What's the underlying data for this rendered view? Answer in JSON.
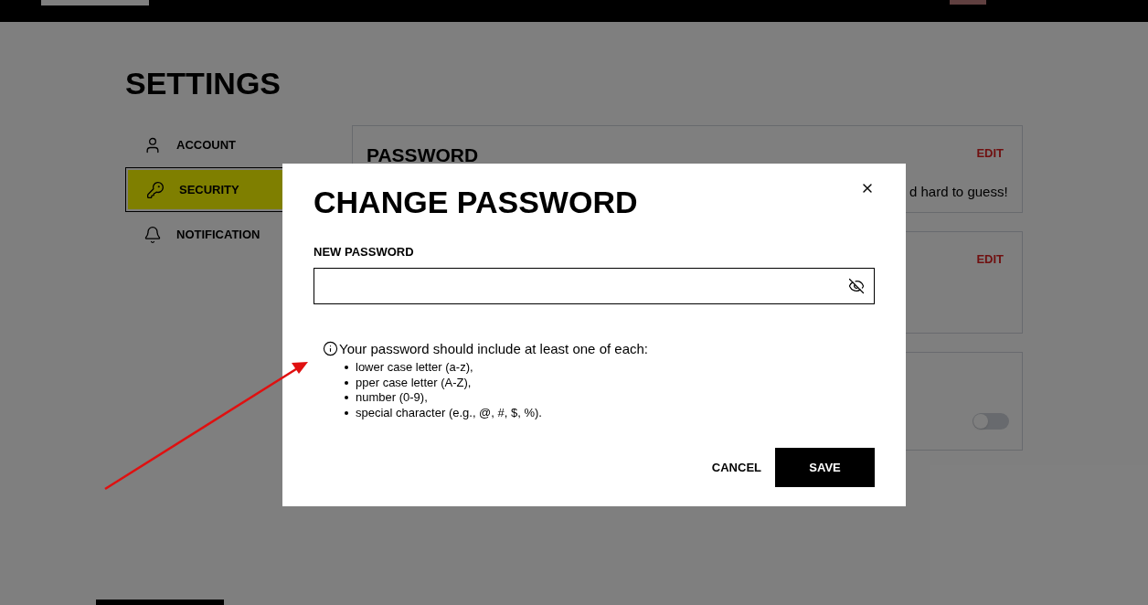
{
  "page": {
    "title": "SETTINGS"
  },
  "sidebar": {
    "items": [
      {
        "label": "ACCOUNT",
        "selected": false
      },
      {
        "label": "SECURITY",
        "selected": true
      },
      {
        "label": "NOTIFICATION",
        "selected": false
      }
    ]
  },
  "cards": [
    {
      "kind": "edit",
      "title": "PASSWORD",
      "action": "EDIT",
      "text": "d hard to guess!"
    },
    {
      "kind": "edit",
      "action": "EDIT"
    },
    {
      "kind": "toggle",
      "on": false
    }
  ],
  "dialog": {
    "title": "CHANGE PASSWORD",
    "field_label": "NEW PASSWORD",
    "password_hidden": true,
    "hint": "Your password should include at least one of each:",
    "rules": [
      "lower case letter (a-z),",
      "pper case letter (A-Z),",
      "number (0-9),",
      "special character (e.g., @, #, $, %)."
    ],
    "buttons": [
      {
        "kind": "text",
        "label": "CANCEL"
      },
      {
        "kind": "primary",
        "label": "SAVE"
      }
    ]
  }
}
